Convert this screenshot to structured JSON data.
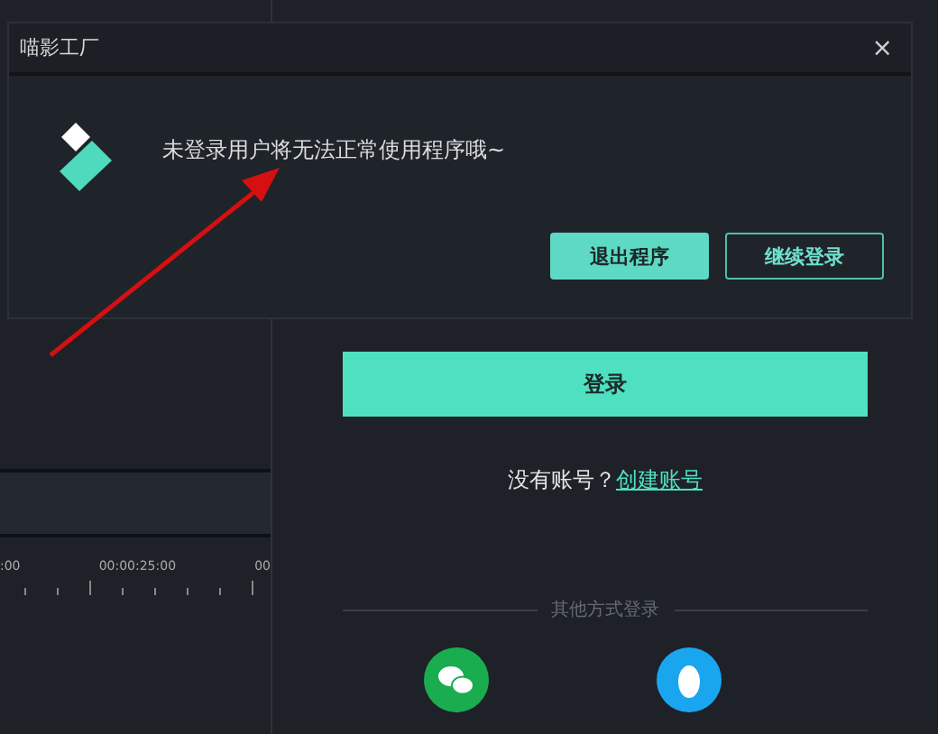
{
  "timeline": {
    "ruler_labels": [
      ":00",
      "00:00:25:00",
      "00"
    ]
  },
  "login": {
    "button": "登录",
    "prompt": "没有账号？",
    "link": "创建账号",
    "other_label": "其他方式登录"
  },
  "dialog": {
    "title": "喵影工厂",
    "close": "×",
    "message": "未登录用户将无法正常使用程序哦~",
    "buttons": [
      {
        "label": "退出程序",
        "kind": "primary"
      },
      {
        "label": "继续登录",
        "kind": "secondary"
      }
    ]
  }
}
